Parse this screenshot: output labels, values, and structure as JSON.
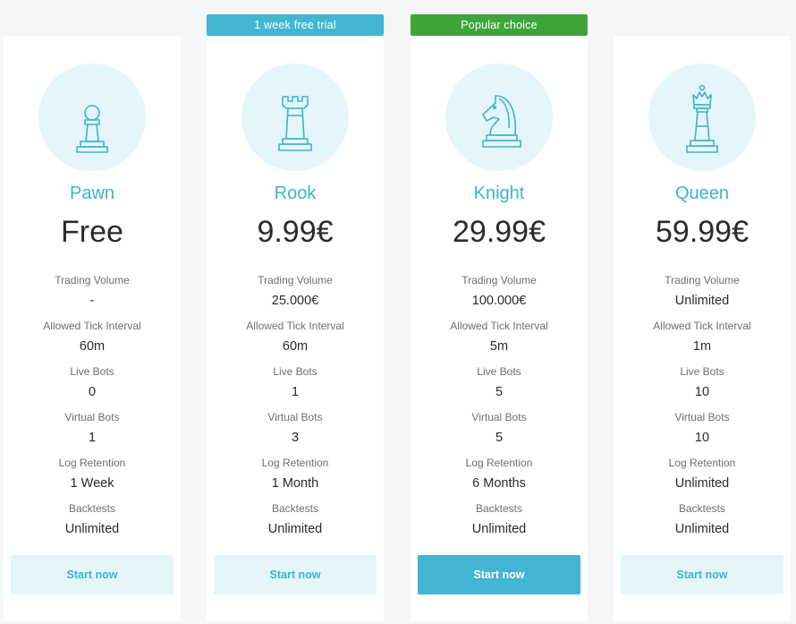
{
  "ribbons": {
    "rook": {
      "text": "1 week free trial",
      "color": "#41b5d1"
    },
    "knight": {
      "text": "Popular choice",
      "color": "#3fa53a"
    }
  },
  "feature_labels": {
    "trading_volume": "Trading Volume",
    "tick_interval": "Allowed Tick Interval",
    "live_bots": "Live Bots",
    "virtual_bots": "Virtual Bots",
    "log_retention": "Log Retention",
    "backtests": "Backtests"
  },
  "plans": [
    {
      "icon": "pawn-icon",
      "name": "Pawn",
      "price": "Free",
      "trading_volume": "-",
      "tick_interval": "60m",
      "live_bots": "0",
      "virtual_bots": "1",
      "log_retention": "1 Week",
      "backtests": "Unlimited",
      "cta": "Start now"
    },
    {
      "icon": "rook-icon",
      "name": "Rook",
      "price": "9.99€",
      "trading_volume": "25.000€",
      "tick_interval": "60m",
      "live_bots": "1",
      "virtual_bots": "3",
      "log_retention": "1 Month",
      "backtests": "Unlimited",
      "cta": "Start now"
    },
    {
      "icon": "knight-icon",
      "name": "Knight",
      "price": "29.99€",
      "trading_volume": "100.000€",
      "tick_interval": "5m",
      "live_bots": "5",
      "virtual_bots": "5",
      "log_retention": "6 Months",
      "backtests": "Unlimited",
      "cta": "Start now"
    },
    {
      "icon": "queen-icon",
      "name": "Queen",
      "price": "59.99€",
      "trading_volume": "Unlimited",
      "tick_interval": "1m",
      "live_bots": "10",
      "virtual_bots": "10",
      "log_retention": "Unlimited",
      "backtests": "Unlimited",
      "cta": "Start now"
    }
  ],
  "colors": {
    "accent": "#3db3cf",
    "button_solid": "#41b5d1",
    "button_light": "#e4f6f9",
    "popular": "#3fa53a"
  }
}
